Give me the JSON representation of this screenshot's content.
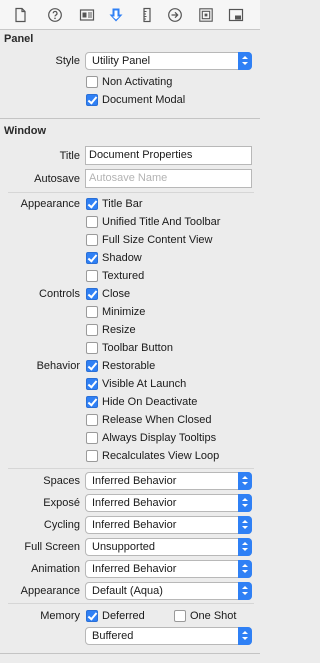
{
  "toolbar": {
    "icons": [
      "file-icon",
      "help-icon",
      "identity-icon",
      "attributes-icon",
      "size-icon",
      "connections-icon",
      "bindings-icon",
      "effects-icon"
    ],
    "active": "attributes-icon",
    "accent": "#2f80f5"
  },
  "panel": {
    "section_title": "Panel",
    "style_label": "Style",
    "style_value": "Utility Panel",
    "non_activating": "Non Activating",
    "document_modal": "Document Modal"
  },
  "window": {
    "section_title": "Window",
    "title_label": "Title",
    "title_value": "Document Properties",
    "autosave_label": "Autosave",
    "autosave_placeholder": "Autosave Name",
    "appearance_label": "Appearance",
    "appearance": [
      "Title Bar",
      "Unified Title And Toolbar",
      "Full Size Content View",
      "Shadow",
      "Textured"
    ],
    "controls_label": "Controls",
    "controls": [
      "Close",
      "Minimize",
      "Resize",
      "Toolbar Button"
    ],
    "behavior_label": "Behavior",
    "behavior": [
      "Restorable",
      "Visible At Launch",
      "Hide On Deactivate",
      "Release When Closed",
      "Always Display Tooltips",
      "Recalculates View Loop"
    ]
  },
  "popups": {
    "spaces_label": "Spaces",
    "spaces_value": "Inferred Behavior",
    "expose_label": "Exposé",
    "expose_value": "Inferred Behavior",
    "cycling_label": "Cycling",
    "cycling_value": "Inferred Behavior",
    "fullscreen_label": "Full Screen",
    "fullscreen_value": "Unsupported",
    "animation_label": "Animation",
    "animation_value": "Inferred Behavior",
    "appearance_label": "Appearance",
    "appearance_value": "Default (Aqua)"
  },
  "memory": {
    "label": "Memory",
    "deferred": "Deferred",
    "one_shot": "One Shot",
    "backing_value": "Buffered"
  }
}
